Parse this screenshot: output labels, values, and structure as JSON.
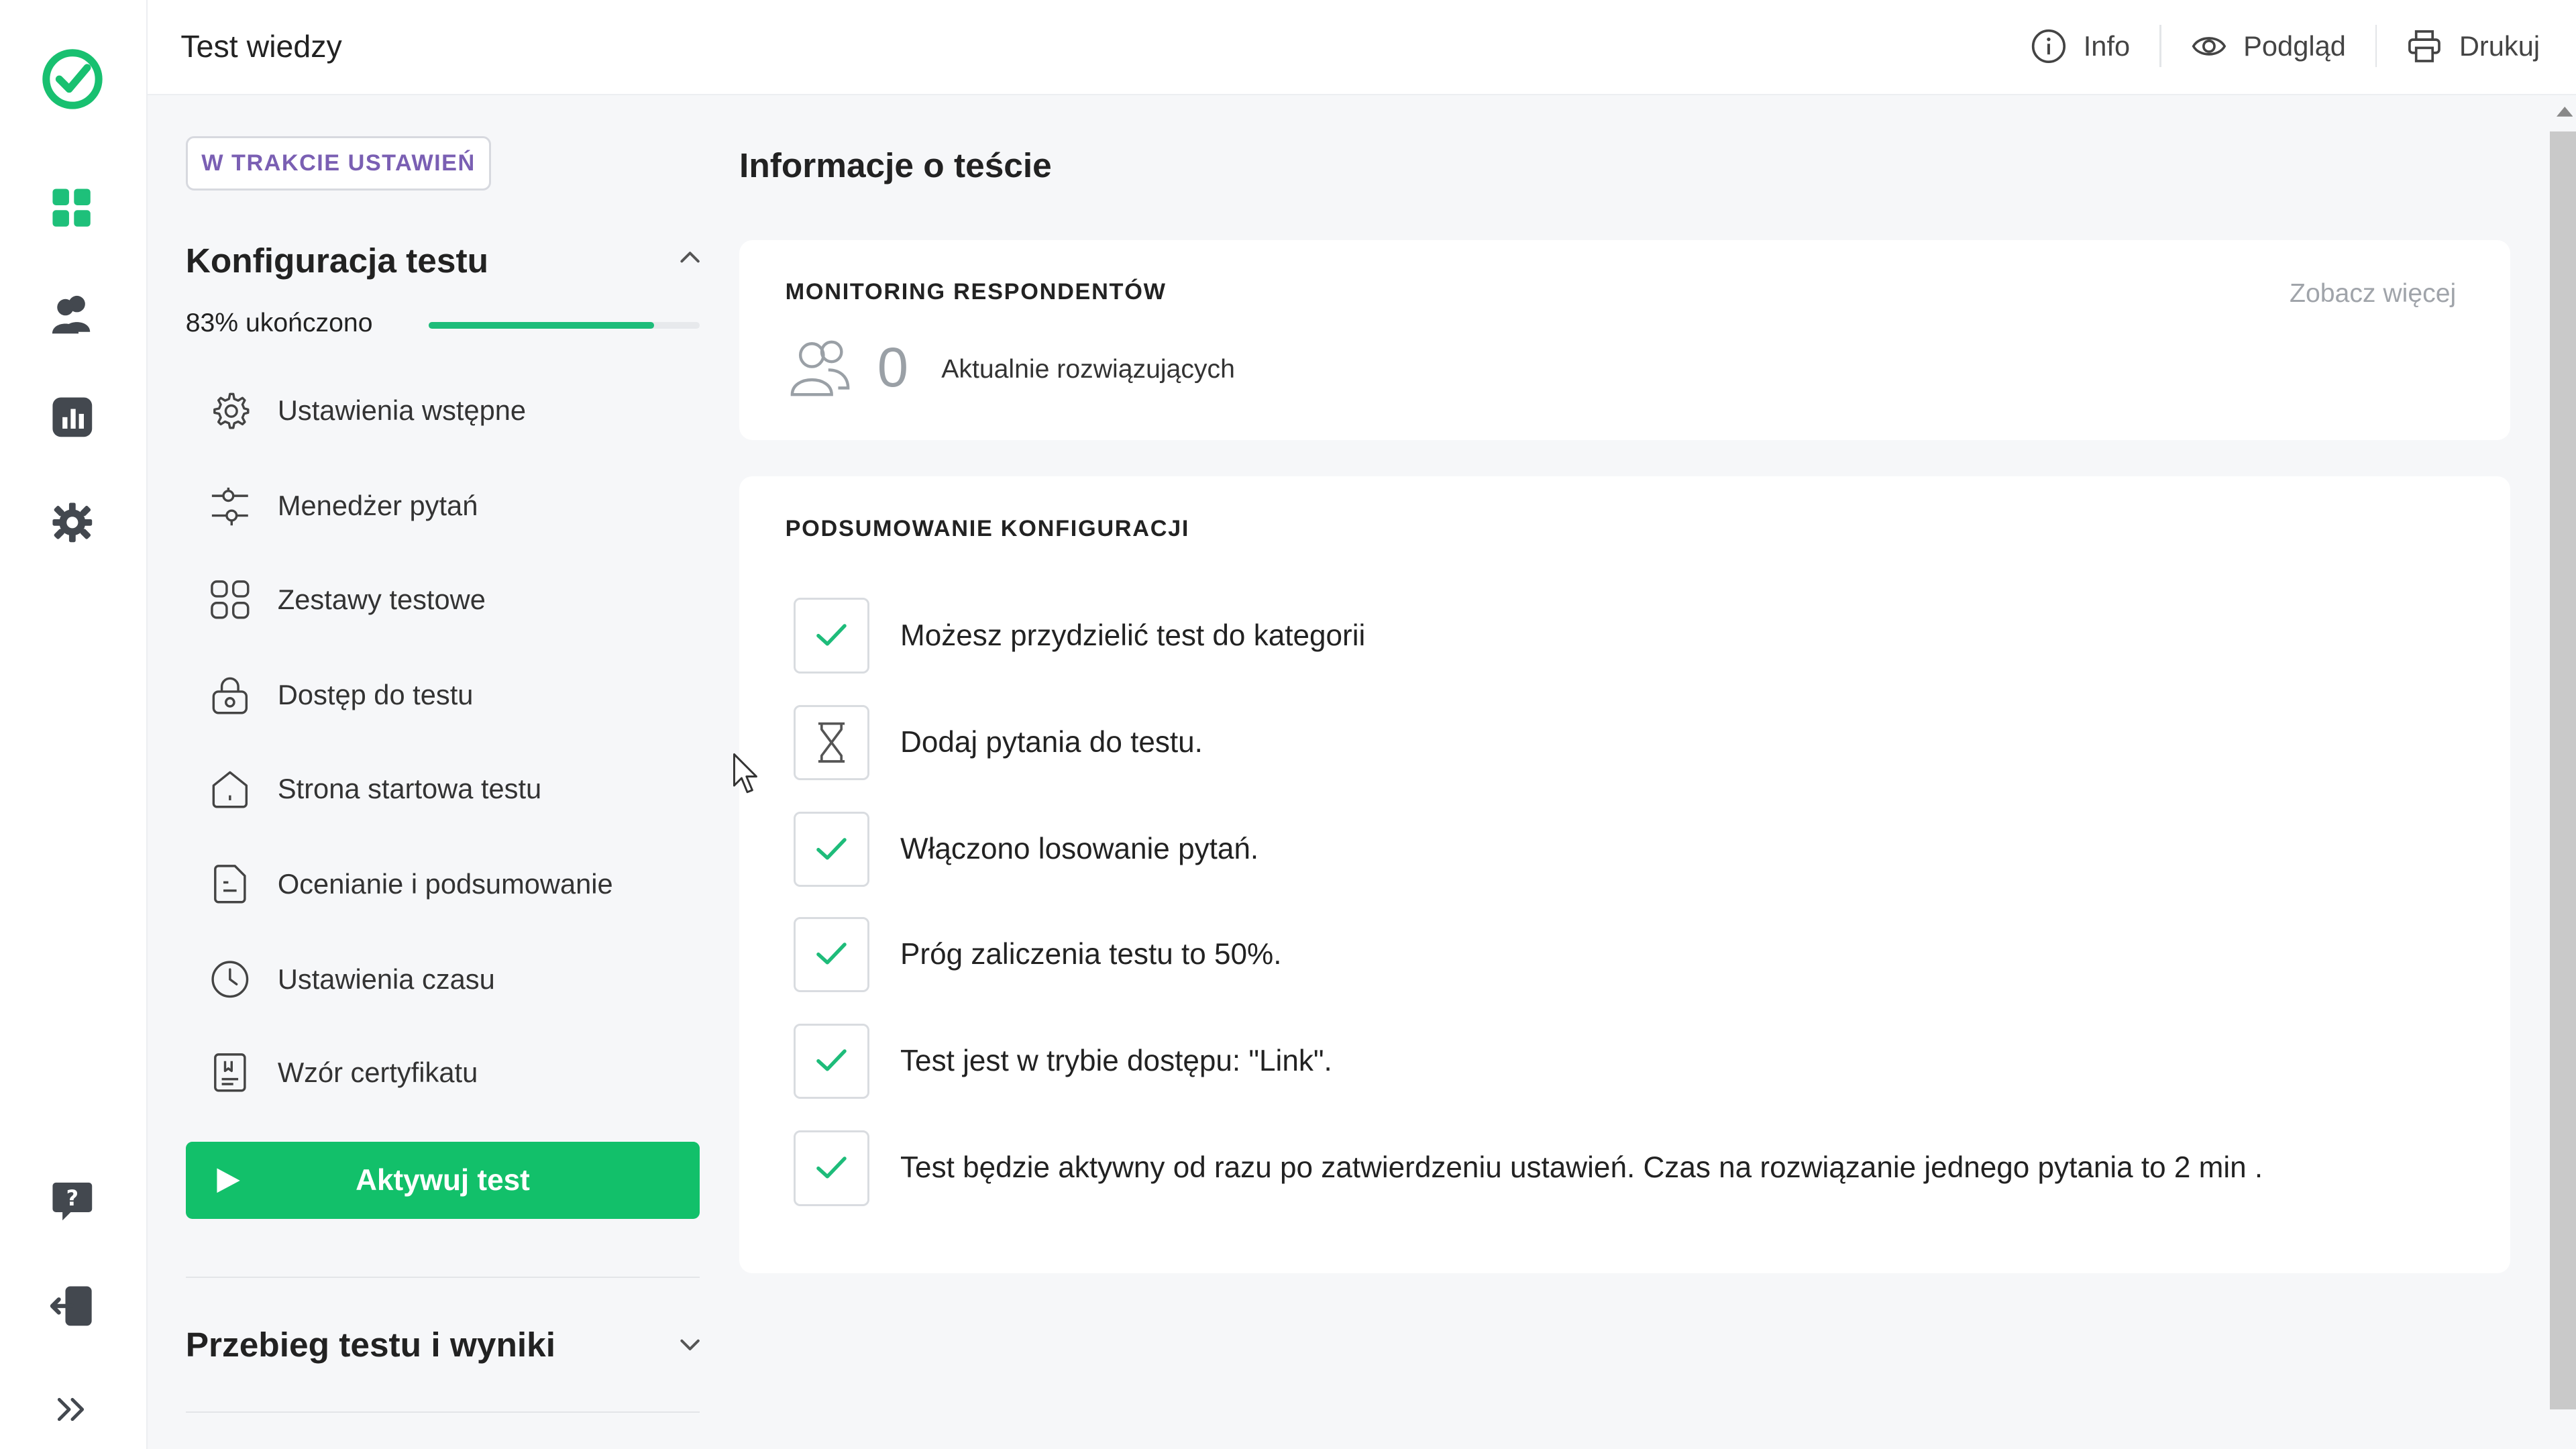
{
  "header": {
    "title": "Test wiedzy",
    "actions": [
      {
        "label": "Info",
        "icon": "info-icon"
      },
      {
        "label": "Podgląd",
        "icon": "eye-icon"
      },
      {
        "label": "Drukuj",
        "icon": "print-icon"
      }
    ]
  },
  "rail": {
    "icons": [
      "logo-check-icon",
      "dashboard-icon",
      "users-icon",
      "stats-icon",
      "settings-icon",
      "help-icon",
      "logout-icon",
      "expand-icon"
    ]
  },
  "sidebar": {
    "status_badge": "W TRAKCIE USTAWIEŃ",
    "config_title": "Konfiguracja testu",
    "progress_label": "83% ukończono",
    "progress_value": 0.83,
    "items": [
      {
        "label": "Ustawienia wstępne",
        "icon": "gear-icon"
      },
      {
        "label": "Menedżer pytań",
        "icon": "sliders-icon"
      },
      {
        "label": "Zestawy testowe",
        "icon": "grid-icon"
      },
      {
        "label": "Dostęp do testu",
        "icon": "lock-icon"
      },
      {
        "label": "Strona startowa testu",
        "icon": "home-icon"
      },
      {
        "label": "Ocenianie i podsumowanie",
        "icon": "document-icon"
      },
      {
        "label": "Ustawienia czasu",
        "icon": "clock-icon"
      },
      {
        "label": "Wzór certyfikatu",
        "icon": "certificate-icon"
      }
    ],
    "activate_label": "Aktywuj test",
    "results_title": "Przebieg testu i wyniki"
  },
  "main": {
    "title": "Informacje o teście",
    "monitoring": {
      "heading": "MONITORING RESPONDENTÓW",
      "see_more": "Zobacz więcej",
      "count": "0",
      "count_label": "Aktualnie rozwiązujących"
    },
    "summary": {
      "heading": "PODSUMOWANIE KONFIGURACJI",
      "items": [
        {
          "text": "Możesz przydzielić test do kategorii",
          "status": "done"
        },
        {
          "text": "Dodaj pytania do testu.",
          "status": "pending"
        },
        {
          "text": "Włączono losowanie pytań.",
          "status": "done"
        },
        {
          "text": "Próg zaliczenia testu to 50%.",
          "status": "done"
        },
        {
          "text": "Test jest w trybie dostępu: \"Link\".",
          "status": "done"
        },
        {
          "text": "Test będzie aktywny od razu po zatwierdzeniu ustawień. Czas na rozwiązanie jednego pytania to 2 min .",
          "status": "done"
        }
      ]
    }
  },
  "colors": {
    "accent": "#12c06a",
    "progress": "#1ebc7a",
    "badge_text": "#7a5fb3",
    "rail_icon": "#43484f"
  }
}
